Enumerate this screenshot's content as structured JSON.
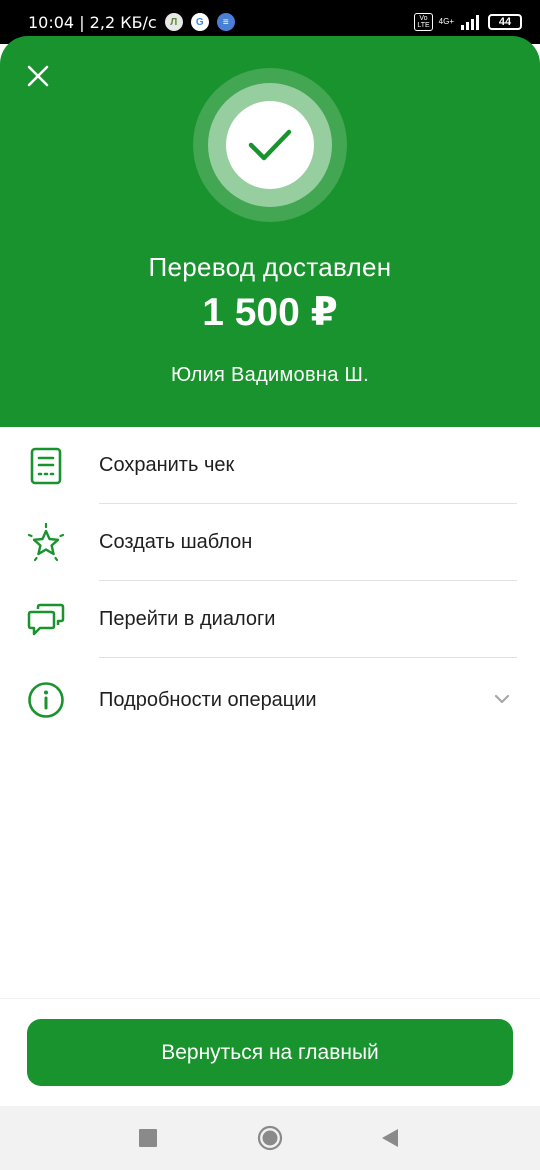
{
  "status_bar": {
    "time": "10:04",
    "speed": "2,2 КБ/с",
    "network": "4G+",
    "volte": "Vo LTE",
    "battery": "44"
  },
  "header": {
    "title": "Перевод доставлен",
    "amount": "1 500 ₽",
    "recipient": "Юлия Вадимовна Ш."
  },
  "actions": [
    {
      "label": "Сохранить чек",
      "icon": "receipt-icon"
    },
    {
      "label": "Создать шаблон",
      "icon": "star-icon"
    },
    {
      "label": "Перейти в диалоги",
      "icon": "chat-icon"
    },
    {
      "label": "Подробности операции",
      "icon": "info-icon"
    }
  ],
  "footer": {
    "button_label": "Вернуться на главный"
  },
  "colors": {
    "brand_green": "#19932d"
  }
}
